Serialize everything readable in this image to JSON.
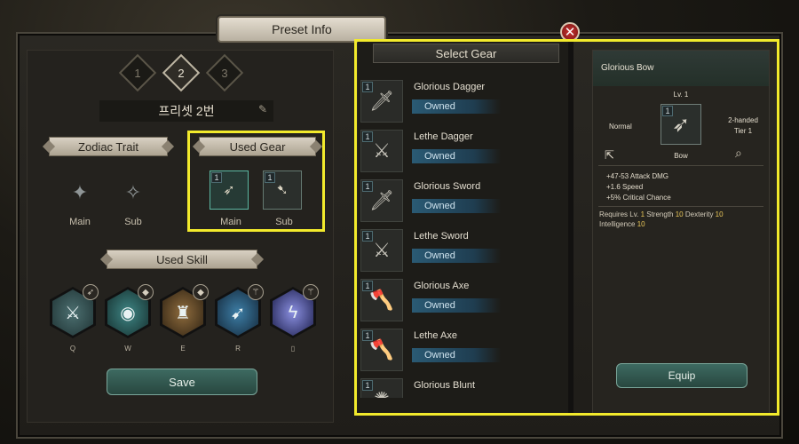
{
  "window": {
    "title": "Preset Info",
    "close_icon": "close-icon"
  },
  "preset": {
    "steps": [
      "1",
      "2",
      "3"
    ],
    "active_step": "2",
    "name": "프리셋 2번",
    "edit_icon": "edit-pencil-icon"
  },
  "zodiac": {
    "title": "Zodiac Trait",
    "main_label": "Main",
    "sub_label": "Sub"
  },
  "used_gear": {
    "title": "Used Gear",
    "main_label": "Main",
    "sub_label": "Sub",
    "main_tier": "1",
    "sub_tier": "1"
  },
  "used_skill": {
    "title": "Used Skill",
    "skills": [
      {
        "key": "Q",
        "icon": "strike-skill-icon"
      },
      {
        "key": "W",
        "icon": "orb-skill-icon"
      },
      {
        "key": "E",
        "icon": "totem-skill-icon"
      },
      {
        "key": "R",
        "icon": "arrow-burst-skill-icon"
      },
      {
        "key": "▯",
        "icon": "lightning-skill-icon"
      }
    ]
  },
  "save_label": "Save",
  "select_gear": {
    "title": "Select Gear",
    "items": [
      {
        "tier": "1",
        "name": "Glorious Dagger",
        "status": "Owned",
        "icon": "dagger-icon"
      },
      {
        "tier": "1",
        "name": "Lethe Dagger",
        "status": "Owned",
        "icon": "curved-dagger-icon"
      },
      {
        "tier": "1",
        "name": "Glorious Sword",
        "status": "Owned",
        "icon": "sword-icon"
      },
      {
        "tier": "1",
        "name": "Lethe Sword",
        "status": "Owned",
        "icon": "broadsword-icon"
      },
      {
        "tier": "1",
        "name": "Glorious Axe",
        "status": "Owned",
        "icon": "axe-icon"
      },
      {
        "tier": "1",
        "name": "Lethe Axe",
        "status": "Owned",
        "icon": "hand-axe-icon"
      },
      {
        "tier": "1",
        "name": "Glorious Blunt",
        "status": "",
        "icon": "mace-icon"
      }
    ]
  },
  "detail": {
    "name": "Glorious Bow",
    "level": "Lv. 1",
    "grade": "Normal",
    "handed": "2-handed",
    "tier_text": "Tier 1",
    "type": "Bow",
    "tier": "1",
    "share_icon": "share-icon",
    "inspect_icon": "magnifier-icon",
    "stats": [
      "+47-53 Attack DMG",
      "+1.6 Speed",
      "+5% Critical Chance"
    ],
    "requirements": {
      "label": "Requires Lv.",
      "level": "1",
      "str_label": "Strength",
      "str": "10",
      "dex_label": "Dexterity",
      "dex": "10",
      "int_label": "Intelligence",
      "int": "10"
    },
    "equip_label": "Equip"
  }
}
